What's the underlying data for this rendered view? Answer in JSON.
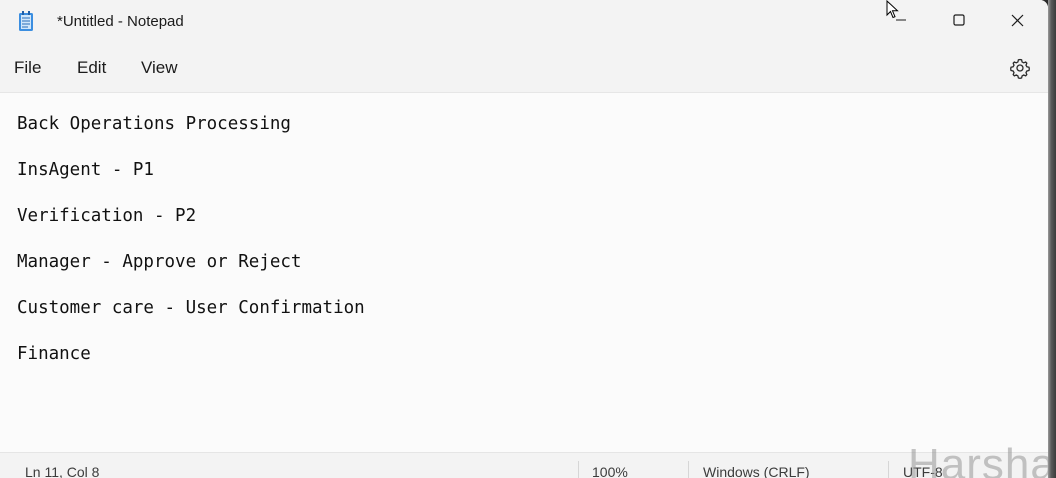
{
  "window": {
    "title": "*Untitled - Notepad",
    "icons": {
      "app": "notepad-icon",
      "minimize": "minimize-icon",
      "maximize": "maximize-icon",
      "close": "close-icon"
    }
  },
  "menu": {
    "file": "File",
    "edit": "Edit",
    "view": "View",
    "settings_icon": "gear-icon"
  },
  "editor": {
    "lines": [
      "Back Operations Processing",
      "InsAgent - P1",
      "Verification - P2",
      "Manager - Approve or Reject",
      "Customer care - User Confirmation",
      "Finance"
    ]
  },
  "status": {
    "position": "Ln 11, Col 8",
    "zoom": "100%",
    "line_ending": "Windows (CRLF)",
    "encoding": "UTF-8"
  },
  "watermark": "Harsha"
}
